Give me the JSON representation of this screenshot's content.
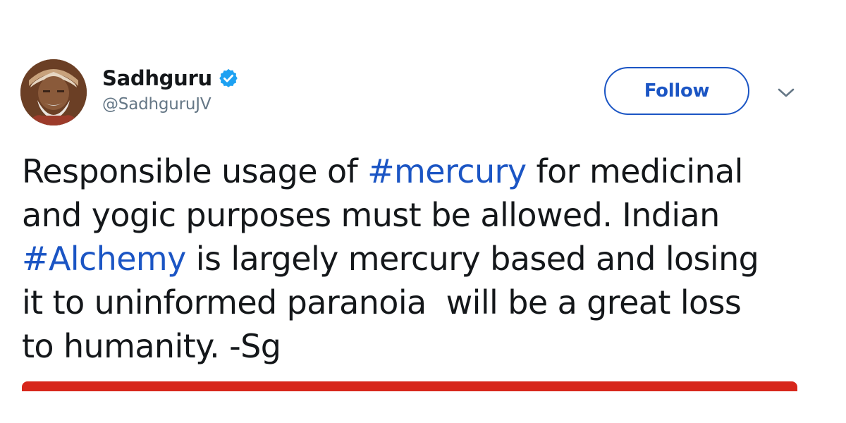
{
  "author": {
    "display_name": "Sadhguru",
    "handle": "@SadhguruJV",
    "verified": true
  },
  "follow_button": {
    "label": "Follow"
  },
  "icons": {
    "verified": "verified-badge-icon",
    "menu": "chevron-down-icon",
    "avatar": "avatar"
  },
  "tweet": {
    "segments": [
      {
        "type": "text",
        "text": "Responsible usage of "
      },
      {
        "type": "hashtag",
        "text": "#mercury"
      },
      {
        "type": "text",
        "text": " for medicinal\nand yogic purposes must be allowed. Indian\n"
      },
      {
        "type": "hashtag",
        "text": "#Alchemy"
      },
      {
        "type": "text",
        "text": " is largely mercury based and losing\nit to uninformed paranoia  will be a great loss\nto humanity. -Sg"
      }
    ]
  },
  "colors": {
    "link": "#1b55c4",
    "verified": "#1da1f2",
    "text": "#14171a",
    "secondary": "#657786",
    "accent_bar": "#d7261b"
  }
}
